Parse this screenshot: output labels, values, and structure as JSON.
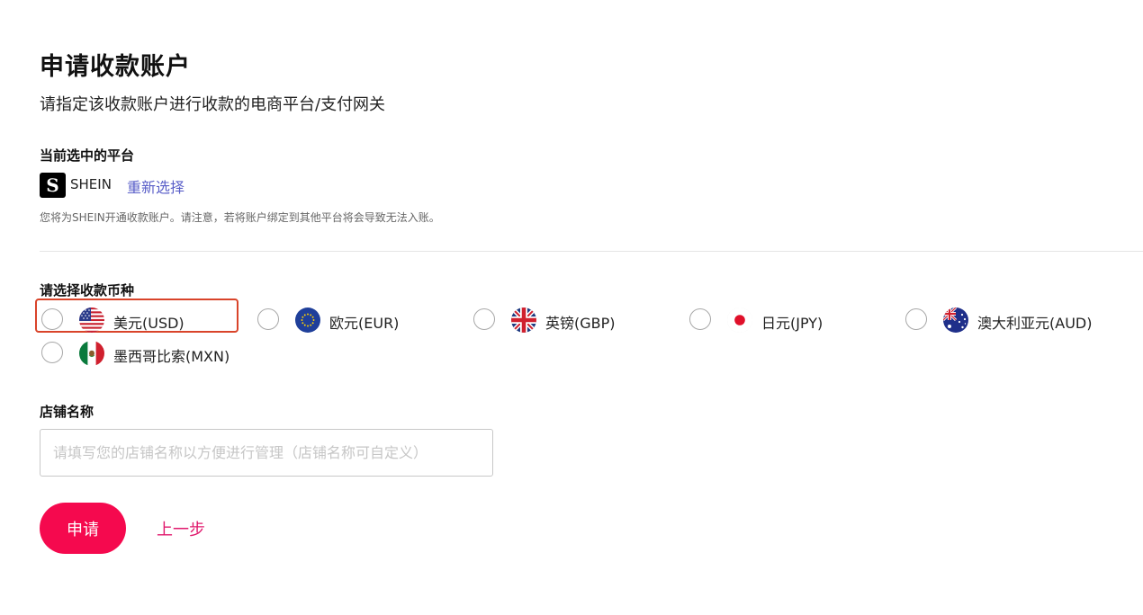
{
  "page": {
    "title": "申请收款账户",
    "subtitle": "请指定该收款账户进行收款的电商平台/支付网关"
  },
  "platform": {
    "section_label": "当前选中的平台",
    "logo_letter": "S",
    "name": "SHEIN",
    "reselect_label": "重新选择",
    "note": "您将为SHEIN开通收款账户。请注意，若将账户绑定到其他平台将会导致无法入账。"
  },
  "currency": {
    "section_label": "请选择收款币种",
    "options": [
      {
        "label": "美元(USD)",
        "flag": "us-flag-icon"
      },
      {
        "label": "欧元(EUR)",
        "flag": "eu-flag-icon"
      },
      {
        "label": "英镑(GBP)",
        "flag": "uk-flag-icon"
      },
      {
        "label": "日元(JPY)",
        "flag": "jp-flag-icon"
      },
      {
        "label": "澳大利亚元(AUD)",
        "flag": "au-flag-icon"
      },
      {
        "label": "墨西哥比索(MXN)",
        "flag": "mx-flag-icon"
      }
    ],
    "highlight_color": "#d9442a"
  },
  "store": {
    "section_label": "店铺名称",
    "value": "",
    "placeholder": "请填写您的店铺名称以方便进行管理（店铺名称可自定义）"
  },
  "actions": {
    "apply_label": "申请",
    "back_label": "上一步",
    "accent_color": "#f5094e",
    "link_color": "#5a5fc8"
  }
}
